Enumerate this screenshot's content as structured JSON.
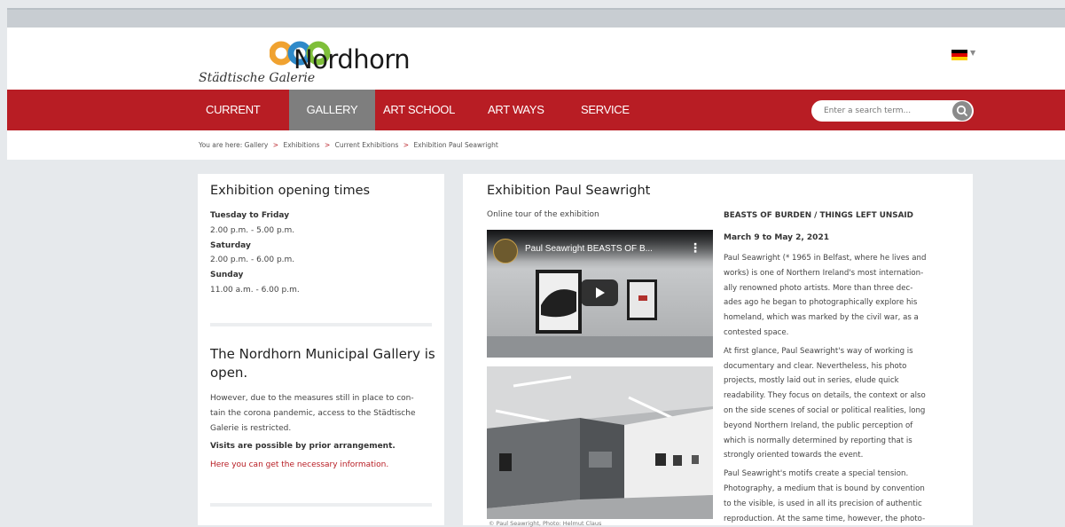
{
  "header": {
    "site_title": "Nordhorn",
    "site_subtitle": "Städtische Galerie",
    "language_flag": "de-flag-icon",
    "logo_colors": [
      "#f0a230",
      "#2e89c9",
      "#7fbf3a"
    ]
  },
  "nav": {
    "items": [
      {
        "label": "CURRENT",
        "active": false
      },
      {
        "label": "GALLERY",
        "active": true
      },
      {
        "label": "ART SCHOOL",
        "active": false
      },
      {
        "label": "ART WAYS",
        "active": false
      },
      {
        "label": "SERVICE",
        "active": false
      }
    ],
    "search_placeholder": "Enter a search term...",
    "accent_color": "#b81d24"
  },
  "breadcrumb": {
    "prefix": "You are here:",
    "items": [
      "Gallery",
      "Exhibitions",
      "Current Exhibitions",
      "Exhibition Paul Seawright"
    ]
  },
  "sidebar": {
    "times_title": "Exhibition opening times",
    "times": [
      {
        "day": "Tuesday to Friday",
        "hours": "2.00 p.m. - 5.00 p.m."
      },
      {
        "day": "Saturday",
        "hours": "2.00 p.m. - 6.00 p.m."
      },
      {
        "day": "Sunday",
        "hours": "11.00 a.m. - 6.00 p.m."
      }
    ],
    "notice_title_line1": "The Nordhorn Municipal Gallery is",
    "notice_title_line2": "open.",
    "notice_lines": [
      "However, due to the measures still in place to con-",
      "tain the corona pandemic, access to the Städtische",
      "Galerie is restricted."
    ],
    "notice_bold": "Visits are possible by prior arrangement.",
    "notice_link": "Here you can get the necessary information."
  },
  "main": {
    "title": "Exhibition Paul Seawright",
    "online_tour_label": "Online tour of the exhibition",
    "video_title": "Paul Seawright BEASTS OF B...",
    "photo_caption": "© Paul Seawright, Photo: Helmut Claus",
    "subtitle": "BEASTS OF BURDEN / THINGS LEFT UNSAID",
    "dates": "March 9 to May 2, 2021",
    "para1": [
      "Paul Seawright (* 1965 in Belfast, where he lives and",
      "works) is one of Northern Ireland's most internation-",
      "ally renowned photo artists. More than three dec-",
      "ades ago he began to photographically explore his",
      "homeland, which was marked by the civil war, as a",
      "contested space."
    ],
    "para2": [
      "At first glance, Paul Seawright's way of working is",
      "documentary and clear. Nevertheless, his photo",
      "projects, mostly laid out in series, elude quick",
      "readability. They focus on details, the context or also",
      "on the side scenes of social or political realities, long",
      "beyond Northern Ireland, the public perception of",
      "which is normally determined by reporting that is",
      "strongly oriented towards the event."
    ],
    "para3": [
      "Paul Seawright's motifs create a special tension.",
      "Photography, a medium that is bound by convention",
      "to the visible, is used in all its precision of authentic",
      "reproduction. At the same time, however, the photo-"
    ]
  }
}
